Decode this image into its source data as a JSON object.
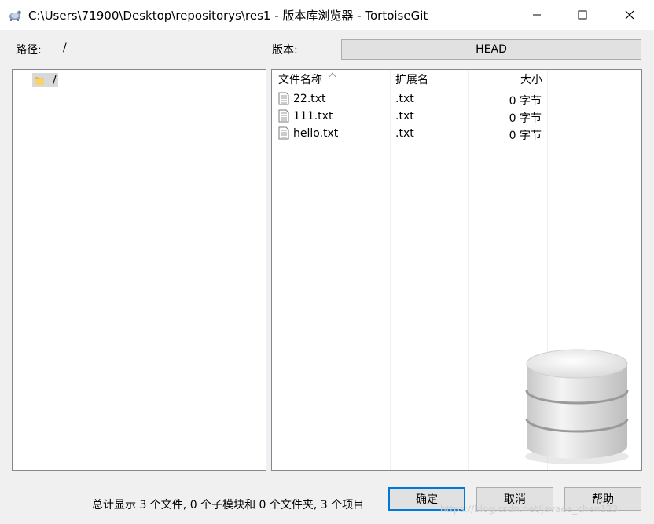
{
  "window": {
    "title": "C:\\Users\\71900\\Desktop\\repositorys\\res1 - 版本库浏览器 - TortoiseGit",
    "app_icon": "tortoisegit-icon"
  },
  "toolbar": {
    "path_label": "路径:",
    "path_value": "/",
    "revision_label": "版本:",
    "revision_value": "HEAD"
  },
  "tree": {
    "root_label": "/",
    "root_icon": "folder-icon"
  },
  "file_list": {
    "columns": [
      "文件名称",
      "扩展名",
      "大小"
    ],
    "sort_column": "文件名称",
    "rows": [
      {
        "name": "22.txt",
        "ext": ".txt",
        "size": "0 字节"
      },
      {
        "name": "111.txt",
        "ext": ".txt",
        "size": "0 字节"
      },
      {
        "name": "hello.txt",
        "ext": ".txt",
        "size": "0 字节"
      }
    ]
  },
  "footer": {
    "summary": "总计显示 3 个文件, 0 个子模块和 0 个文件夹, 3 个项目",
    "ok_label": "确定",
    "cancel_label": "取消",
    "help_label": "帮助",
    "watermark": "https://blog.csdn.net/javaee_chen123"
  },
  "colors": {
    "focus_border": "#0078d7",
    "window_bg": "#f0f0f0",
    "tree_selection": "#d9d9d9"
  }
}
